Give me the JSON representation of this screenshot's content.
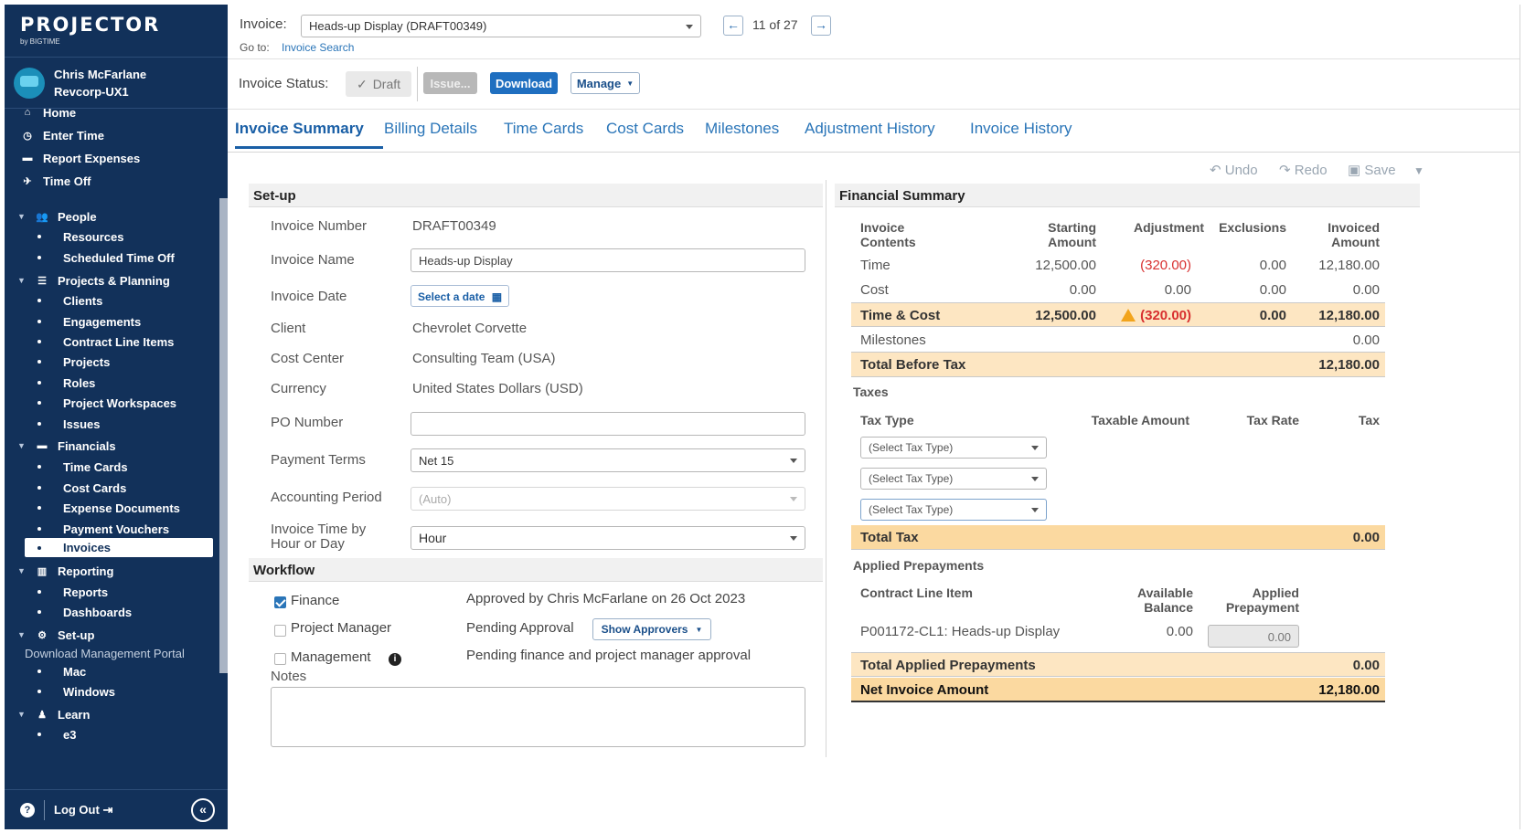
{
  "brand": {
    "name": "PROJECTOR",
    "sub": "by BIGTIME"
  },
  "user": {
    "name": "Chris McFarlane",
    "org": "Revcorp-UX1"
  },
  "nav": {
    "home": "Home",
    "enter_time": "Enter Time",
    "report_expenses": "Report Expenses",
    "time_off": "Time Off",
    "people": "People",
    "resources": "Resources",
    "scheduled_time_off": "Scheduled Time Off",
    "projects_planning": "Projects & Planning",
    "clients": "Clients",
    "engagements": "Engagements",
    "contract_line_items": "Contract Line Items",
    "projects": "Projects",
    "roles": "Roles",
    "project_workspaces": "Project Workspaces",
    "issues": "Issues",
    "financials": "Financials",
    "time_cards": "Time Cards",
    "cost_cards": "Cost Cards",
    "expense_documents": "Expense Documents",
    "payment_vouchers": "Payment Vouchers",
    "invoices": "Invoices",
    "reporting": "Reporting",
    "reports": "Reports",
    "dashboards": "Dashboards",
    "setup": "Set-up",
    "download_portal": "Download Management Portal",
    "mac": "Mac",
    "windows": "Windows",
    "learn": "Learn",
    "e3": "e3",
    "logout": "Log Out"
  },
  "header": {
    "invoice_label": "Invoice:",
    "invoice_select": "Heads-up Display (DRAFT00349)",
    "pager": "11 of 27",
    "goto_label": "Go to:",
    "goto_link": "Invoice Search"
  },
  "status": {
    "label": "Invoice Status:",
    "draft": "Draft",
    "issue": "Issue...",
    "download": "Download",
    "manage": "Manage"
  },
  "tabs": [
    "Invoice Summary",
    "Billing Details",
    "Time Cards",
    "Cost Cards",
    "Milestones",
    "Adjustment History",
    "Invoice History"
  ],
  "toolbar": {
    "undo": "Undo",
    "redo": "Redo",
    "save": "Save"
  },
  "setup": {
    "title": "Set-up",
    "invoice_number_label": "Invoice Number",
    "invoice_number": "DRAFT00349",
    "invoice_name_label": "Invoice Name",
    "invoice_name": "Heads-up Display",
    "invoice_date_label": "Invoice Date",
    "invoice_date_btn": "Select a date",
    "client_label": "Client",
    "client": "Chevrolet Corvette",
    "cost_center_label": "Cost Center",
    "cost_center": "Consulting Team (USA)",
    "currency_label": "Currency",
    "currency": "United States Dollars (USD)",
    "po_label": "PO Number",
    "po": "",
    "payment_terms_label": "Payment Terms",
    "payment_terms": "Net 15",
    "accounting_period_label": "Accounting Period",
    "accounting_period": "(Auto)",
    "time_by_label_1": "Invoice Time by",
    "time_by_label_2": "Hour or Day",
    "time_by": "Hour"
  },
  "workflow": {
    "title": "Workflow",
    "finance_label": "Finance",
    "finance_status": "Approved by Chris McFarlane on 26 Oct 2023",
    "pm_label": "Project Manager",
    "pm_status": "Pending Approval",
    "show_approvers": "Show Approvers",
    "mgmt_label": "Management",
    "mgmt_status": "Pending finance and project manager approval",
    "notes_label": "Notes"
  },
  "financial": {
    "title": "Financial Summary",
    "headers": {
      "contents_1": "Invoice",
      "contents_2": "Contents",
      "starting_1": "Starting",
      "starting_2": "Amount",
      "adjustment": "Adjustment",
      "exclusions": "Exclusions",
      "invoiced_1": "Invoiced",
      "invoiced_2": "Amount"
    },
    "rows": [
      {
        "label": "Time",
        "starting": "12,500.00",
        "adjustment": "(320.00)",
        "exclusions": "0.00",
        "invoiced": "12,180.00"
      },
      {
        "label": "Cost",
        "starting": "0.00",
        "adjustment": "0.00",
        "exclusions": "0.00",
        "invoiced": "0.00"
      },
      {
        "label": "Time & Cost",
        "starting": "12,500.00",
        "adjustment": "(320.00)",
        "exclusions": "0.00",
        "invoiced": "12,180.00"
      }
    ],
    "milestones_label": "Milestones",
    "milestones": "0.00",
    "total_before_tax_label": "Total Before Tax",
    "total_before_tax": "12,180.00",
    "taxes_title": "Taxes",
    "tax_headers": {
      "type": "Tax Type",
      "taxable": "Taxable Amount",
      "rate": "Tax Rate",
      "tax": "Tax"
    },
    "tax_select": "(Select Tax Type)",
    "total_tax_label": "Total Tax",
    "total_tax": "0.00",
    "prepay_title": "Applied Prepayments",
    "prepay_headers": {
      "cli": "Contract Line Item",
      "avail_1": "Available",
      "avail_2": "Balance",
      "applied_1": "Applied",
      "applied_2": "Prepayment"
    },
    "prepay_row": {
      "cli": "P001172-CL1: Heads-up Display",
      "avail": "0.00",
      "applied": "0.00"
    },
    "total_prepay_label": "Total Applied Prepayments",
    "total_prepay": "0.00",
    "net_label": "Net Invoice Amount",
    "net": "12,180.00"
  },
  "colors": {
    "sidebar": "#12315a",
    "accent": "#2a75b8",
    "highlight": "#fde6c2",
    "negative": "#d83030"
  }
}
